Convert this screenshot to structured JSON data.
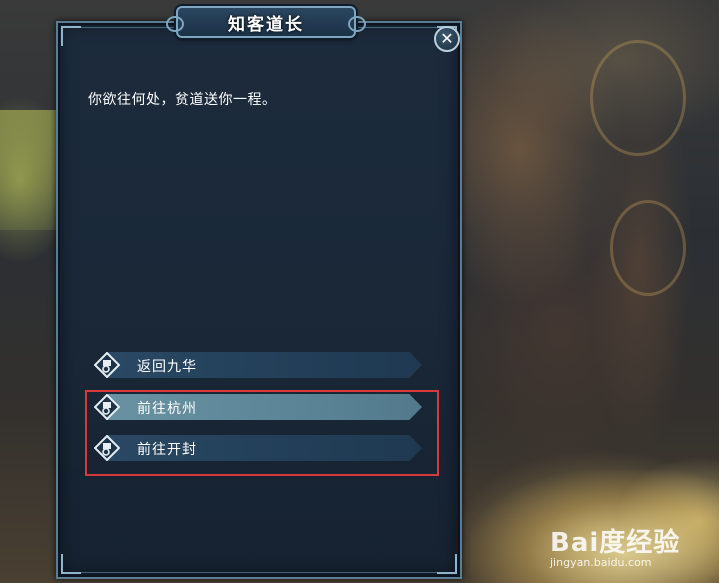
{
  "dialog": {
    "title": "知客道长",
    "message": "你欲往何处，贫道送你一程。",
    "close_symbol": "✕"
  },
  "options": [
    {
      "label": "返回九华",
      "selected": false
    },
    {
      "label": "前往杭州",
      "selected": true
    },
    {
      "label": "前往开封",
      "selected": false
    }
  ],
  "watermark": {
    "logo": "Bai度经验",
    "url": "jingyan.baidu.com"
  },
  "colors": {
    "panel_bg": "#1a2838",
    "option_bar": "#2b4a66",
    "option_selected": "#6d97a8",
    "highlight_border": "#d63a3a"
  },
  "icons": {
    "option_icon": "teleport-diamond-icon",
    "close": "close-icon"
  }
}
